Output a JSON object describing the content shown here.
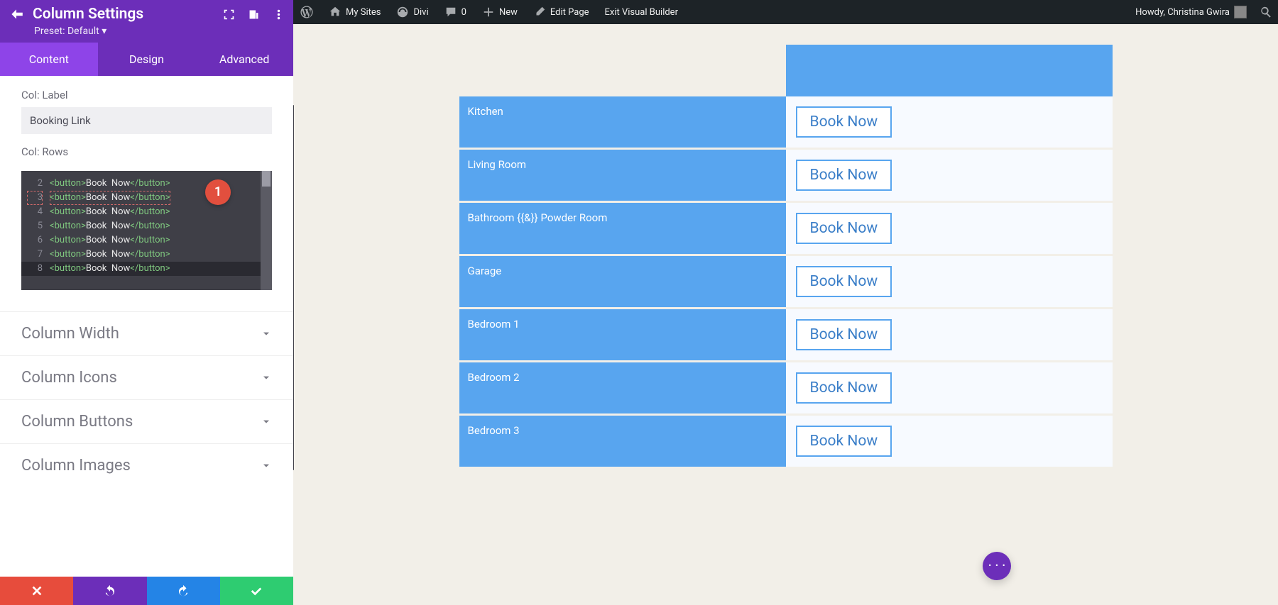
{
  "adminbar": {
    "my_sites": "My Sites",
    "divi": "Divi",
    "comments_count": "0",
    "new": "New",
    "edit": "Edit Page",
    "exit": "Exit Visual Builder",
    "howdy": "Howdy, Christina Gwira"
  },
  "panel": {
    "title": "Column Settings",
    "preset": "Preset: Default",
    "tabs": {
      "content": "Content",
      "design": "Design",
      "advanced": "Advanced"
    },
    "col_label_label": "Col: Label",
    "col_label_value": "Booking Link",
    "col_rows_label": "Col: Rows",
    "code_lines": [
      {
        "n": "2",
        "t": "<button>Book Now</button>"
      },
      {
        "n": "3",
        "t": "<button>Book Now</button>"
      },
      {
        "n": "4",
        "t": "<button>Book Now</button>"
      },
      {
        "n": "5",
        "t": "<button>Book Now</button>"
      },
      {
        "n": "6",
        "t": "<button>Book Now</button>"
      },
      {
        "n": "7",
        "t": "<button>Book Now</button>"
      },
      {
        "n": "8",
        "t": "<button>Book Now</button>"
      }
    ],
    "marker": "1",
    "accordions": {
      "width": "Column Width",
      "icons": "Column Icons",
      "buttons": "Column Buttons",
      "images": "Column Images"
    }
  },
  "table": {
    "rows": [
      "Kitchen",
      "Living Room",
      "Bathroom {{&}} Powder Room",
      "Garage",
      "Bedroom 1",
      "Bedroom 2",
      "Bedroom 3"
    ],
    "button_label": "Book Now"
  }
}
